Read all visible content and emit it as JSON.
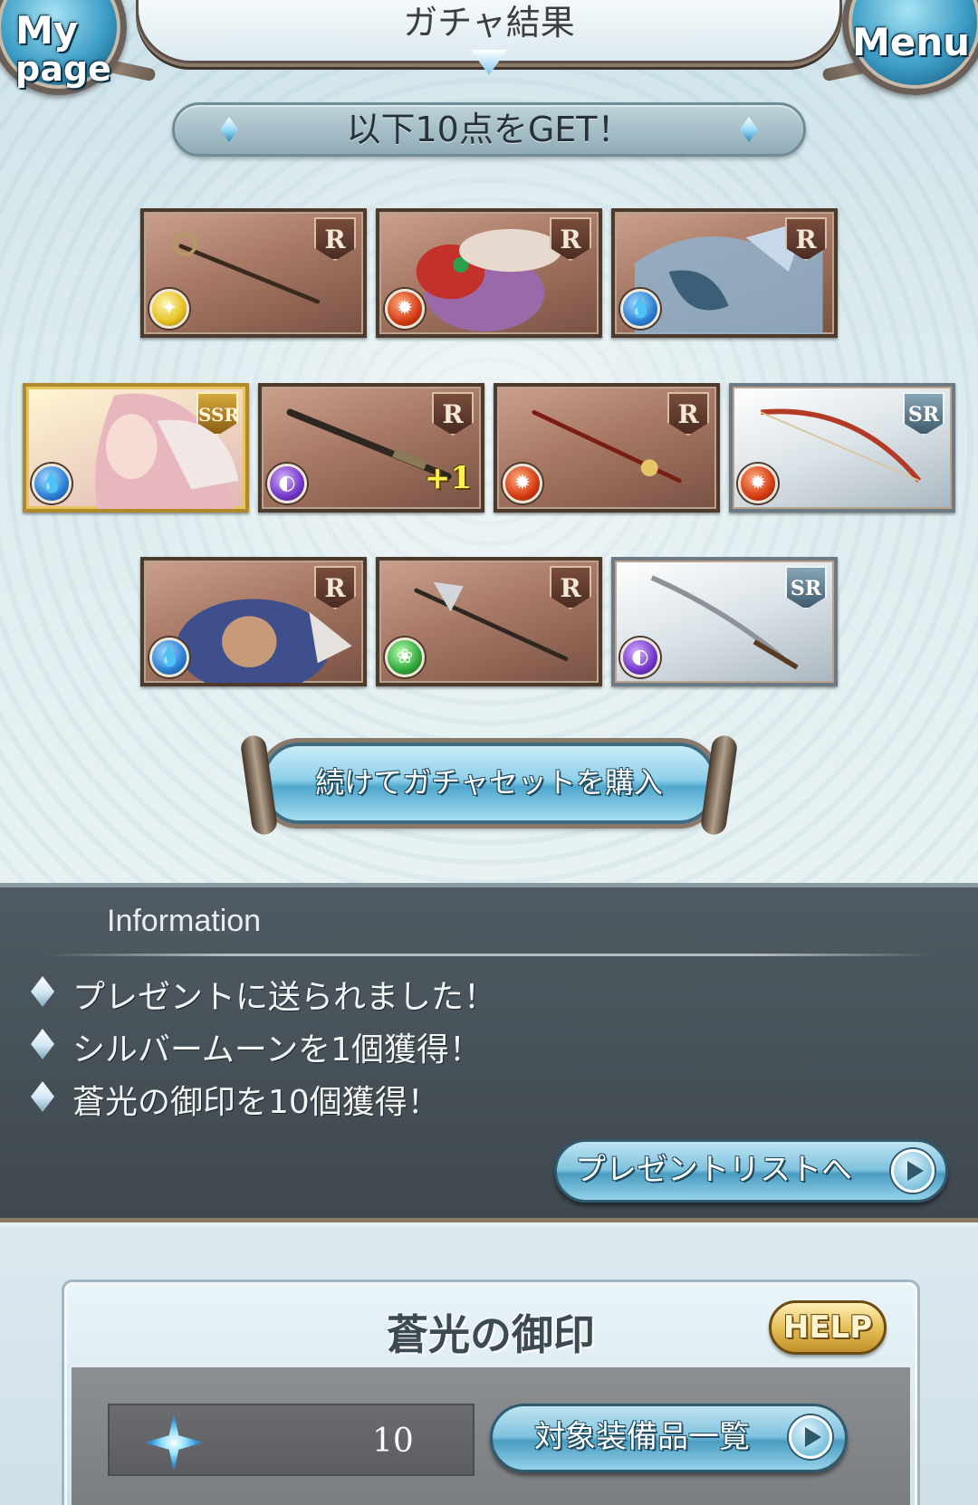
{
  "header": {
    "title": "ガチャ結果",
    "mypage_label_line1": "My",
    "mypage_label_line2": "page",
    "menu_label": "Menu"
  },
  "banner": {
    "text": "以下10点をGET！"
  },
  "items": [
    {
      "rarity": "R",
      "element": "light",
      "kind": "weapon-staff"
    },
    {
      "rarity": "R",
      "element": "fire",
      "kind": "summon-bird"
    },
    {
      "rarity": "R",
      "element": "water",
      "kind": "summon-dragon"
    },
    {
      "rarity": "SSR",
      "element": "water",
      "kind": "character-angel"
    },
    {
      "rarity": "R",
      "element": "dark",
      "kind": "weapon-gun",
      "plus": "+1"
    },
    {
      "rarity": "R",
      "element": "fire",
      "kind": "weapon-spear"
    },
    {
      "rarity": "SR",
      "element": "fire",
      "kind": "weapon-bow"
    },
    {
      "rarity": "R",
      "element": "water",
      "kind": "summon-beast"
    },
    {
      "rarity": "R",
      "element": "wind",
      "kind": "weapon-halberd"
    },
    {
      "rarity": "SR",
      "element": "dark",
      "kind": "weapon-katana"
    }
  ],
  "continue_button": {
    "label": "続けてガチャセットを購入"
  },
  "information": {
    "title": "Information",
    "lines": [
      "プレゼントに送られました！",
      "シルバームーンを1個獲得！",
      "蒼光の御印を10個獲得！"
    ],
    "present_list_button": "プレゼントリストへ"
  },
  "seal": {
    "title": "蒼光の御印",
    "help_label": "HELP",
    "count": "10",
    "target_list_button": "対象装備品一覧"
  }
}
